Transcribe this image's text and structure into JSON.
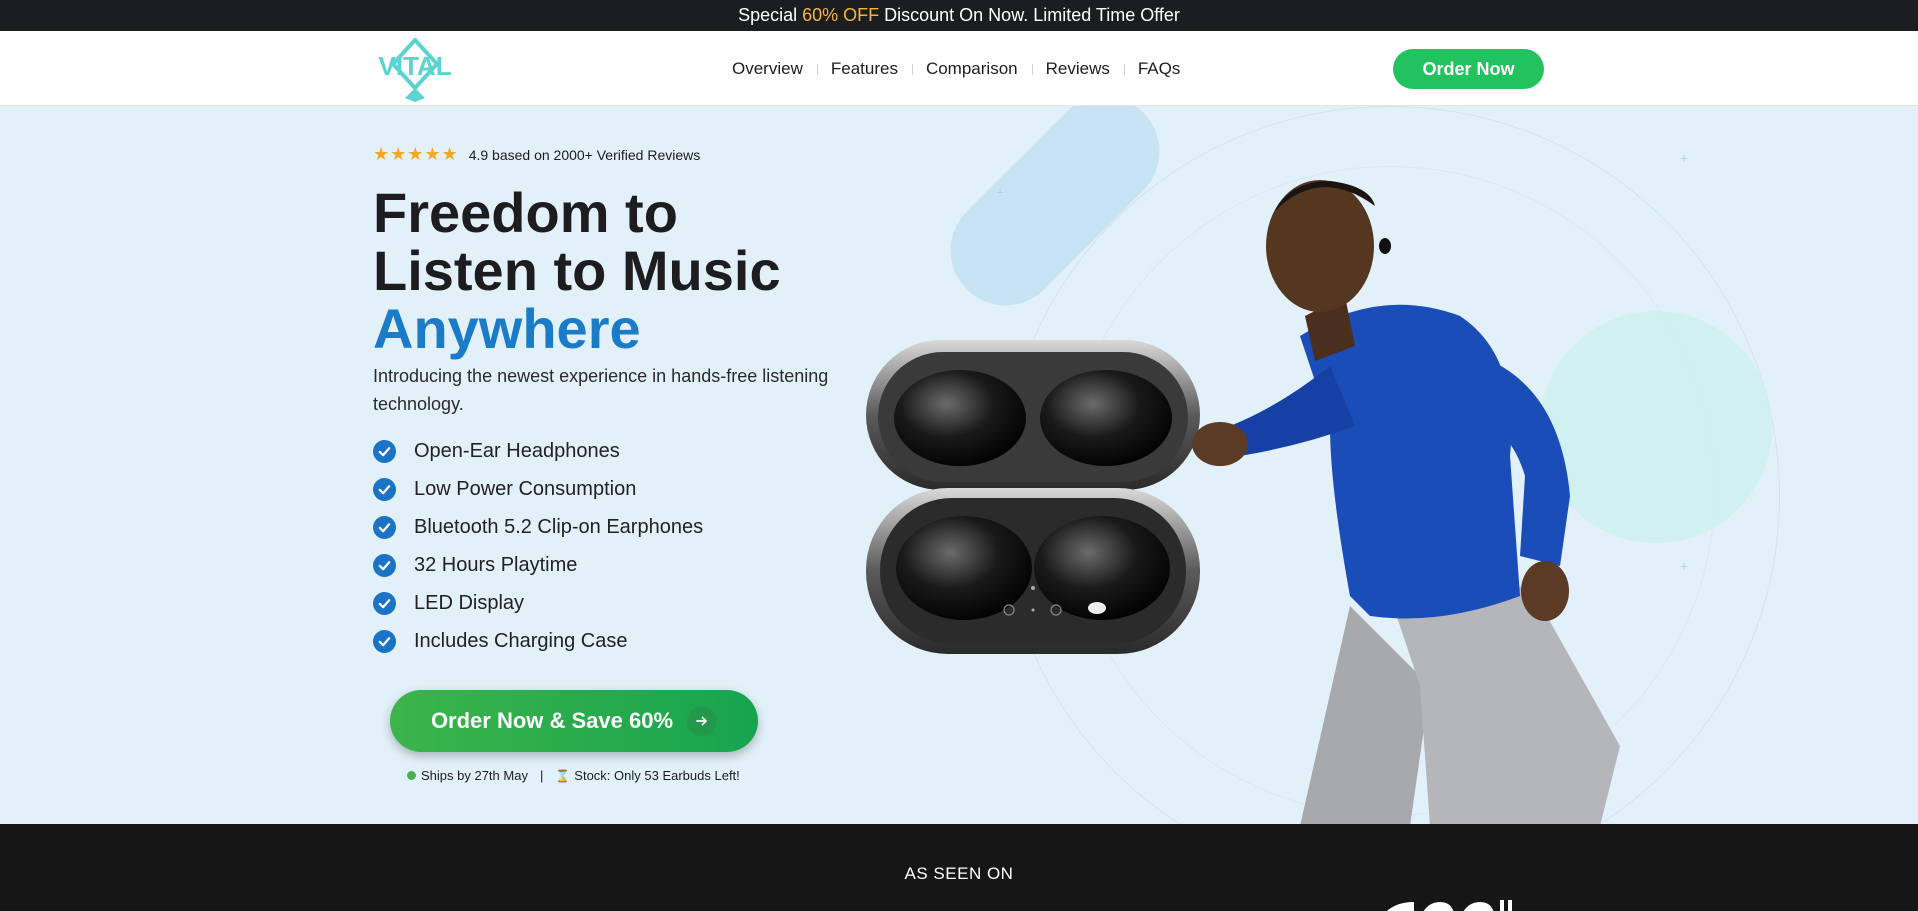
{
  "promo": {
    "prefix": "Special ",
    "highlight": "60% OFF",
    "suffix": " Discount On Now. Limited Time Offer"
  },
  "header": {
    "logo_text": "VITAL",
    "nav": [
      "Overview",
      "Features",
      "Comparison",
      "Reviews",
      "FAQs"
    ],
    "order_label": "Order Now"
  },
  "hero": {
    "stars": "★★★★★",
    "rating_text": "4.9 based on 2000+ Verified Reviews",
    "headline_line1": "Freedom to",
    "headline_line2": "Listen to Music",
    "headline_accent": "Anywhere",
    "intro": "Introducing the newest experience in hands-free listening technology.",
    "features": [
      "Open-Ear Headphones",
      "Low Power Consumption",
      "Bluetooth 5.2 Clip-on Earphones",
      "32 Hours Playtime",
      "LED Display",
      "Includes Charging Case"
    ],
    "cta_label": "Order Now & Save 60%",
    "ships_text": "Ships by 27th May",
    "separator": "|",
    "stock_text": "Stock: Only 53 Earbuds Left!"
  },
  "band": {
    "label": "AS SEEN ON"
  },
  "colors": {
    "accent_blue": "#1a7bc8",
    "cta_green": "#22c35e",
    "hero_bg": "#e2f0f9",
    "promo_highlight": "#f7b731"
  },
  "icons": {
    "logo": "vital-diamond-logo",
    "star": "star-icon",
    "check": "check-circle-icon",
    "arrow": "arrow-right-icon",
    "dot": "green-dot-icon",
    "hourglass": "hourglass-icon"
  }
}
